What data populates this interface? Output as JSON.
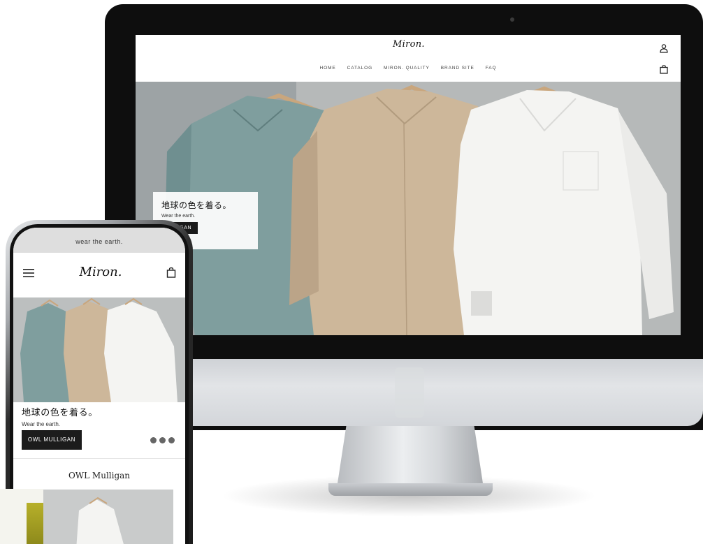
{
  "desktop": {
    "logo": "Miron.",
    "nav": [
      "HOME",
      "CATALOG",
      "MIRON. QUALITY",
      "BRAND SITE",
      "FAQ"
    ],
    "hero": {
      "headline": "地球の色を着る。",
      "subtext": "Wear the earth.",
      "cta": "OWL MULLIGAN",
      "cta_visible": "ULLIGAN"
    },
    "icons": {
      "account": "user-icon",
      "cart": "shopping-bag-icon"
    }
  },
  "mobile": {
    "announcement": "wear the earth.",
    "logo": "Miron.",
    "hero": {
      "headline": "地球の色を着る。",
      "subtext": "Wear the earth.",
      "cta": "OWL MULLIGAN"
    },
    "carousel": {
      "count": 3
    },
    "section_title": "OWL Mulligan",
    "icons": {
      "menu": "hamburger-menu-icon",
      "cart": "shopping-bag-icon"
    }
  },
  "colors": {
    "shirt_blue": "#7f9e9e",
    "shirt_beige": "#cdb79a",
    "shirt_white": "#f4f4f2",
    "button_dark": "#1a1a1a",
    "accent": "#a9a424"
  }
}
